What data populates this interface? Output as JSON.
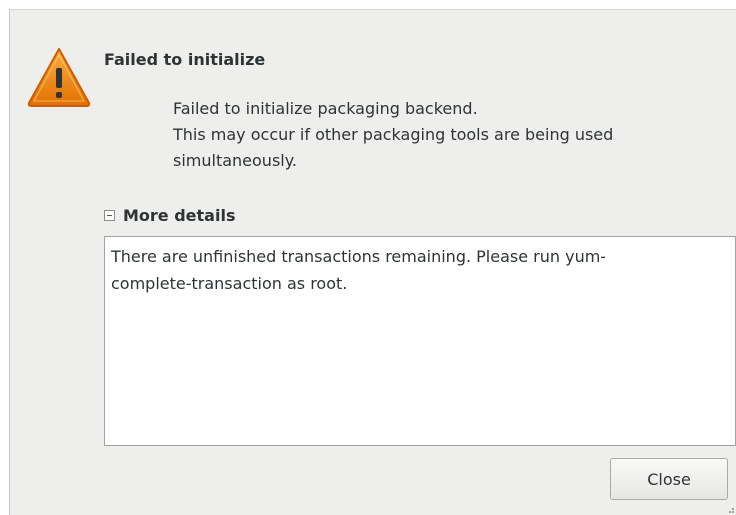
{
  "dialog": {
    "title": "Failed to initialize",
    "message_lines": [
      "Failed to initialize packaging backend.",
      "This may occur if other packaging tools are being used",
      "simultaneously."
    ],
    "icon": "warning-icon",
    "expander": {
      "label": "More details",
      "expanded": true
    },
    "details_lines": [
      "There are unfinished transactions remaining. Please run yum-",
      "complete-transaction as root."
    ],
    "close_label": "Close"
  },
  "colors": {
    "background": "#eeeeec",
    "text": "#2e3436",
    "warning_orange": "#f57900"
  }
}
